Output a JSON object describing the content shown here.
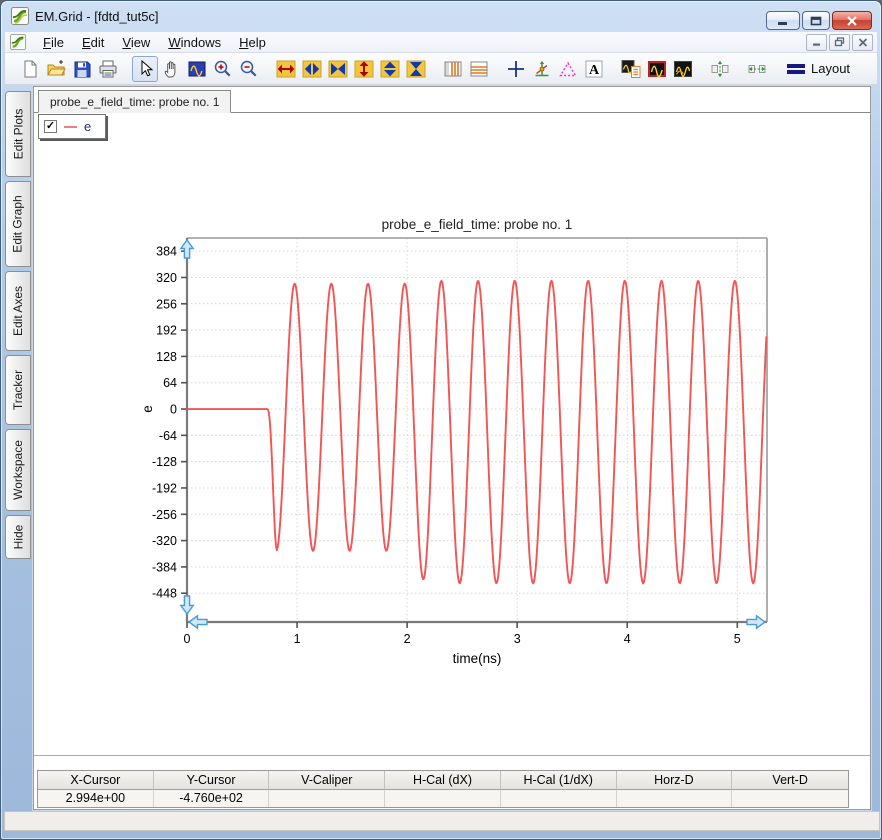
{
  "window": {
    "title": "EM.Grid - [fdtd_tut5c]",
    "controls": [
      "minimize",
      "maximize",
      "close"
    ],
    "child_controls": [
      "minimize",
      "restore",
      "close"
    ]
  },
  "menu": {
    "items": [
      {
        "label": "File",
        "underline": 0
      },
      {
        "label": "Edit",
        "underline": 0
      },
      {
        "label": "View",
        "underline": 0
      },
      {
        "label": "Windows",
        "underline": 0
      },
      {
        "label": "Help",
        "underline": 0
      }
    ]
  },
  "toolbar": {
    "pressed": "select-tool",
    "layout_label": "Layout",
    "groups": [
      [
        "new-document",
        "open-file",
        "save",
        "print"
      ],
      [
        "select-tool",
        "pan-tool",
        "zoom-window",
        "zoom-in",
        "zoom-out"
      ],
      [
        "h-expand",
        "h-shrink",
        "h-bowtie",
        "v-expand",
        "v-shrink",
        "v-bowtie"
      ],
      [
        "vertical-grid",
        "horizontal-grid"
      ],
      [
        "crosshair",
        "tracker-axes",
        "caliper-triangle",
        "text-label"
      ],
      [
        "plot-with-legend",
        "plot-single",
        "plot-multi"
      ],
      [
        "fit-vertical"
      ],
      [
        "fit-horizontal"
      ],
      [
        "layout"
      ]
    ]
  },
  "sidebar": {
    "tabs": [
      "Edit Plots",
      "Edit Graph",
      "Edit Axes",
      "Tracker",
      "Workspace",
      "Hide"
    ]
  },
  "document": {
    "tab_label": "probe_e_field_time: probe no. 1"
  },
  "legend": {
    "checked": true,
    "series_label": "e",
    "line_color": "#f08080"
  },
  "chart_data": {
    "type": "line",
    "title": "probe_e_field_time: probe no. 1",
    "xlabel": "time(ns)",
    "ylabel": "e",
    "xlim": [
      0,
      5.27
    ],
    "ylim": [
      -518,
      416
    ],
    "xticks": [
      0,
      1,
      2,
      3,
      4,
      5
    ],
    "yticks": [
      384,
      320,
      256,
      192,
      128,
      64,
      0,
      -64,
      -128,
      -192,
      -256,
      -320,
      -384,
      -448
    ],
    "grid": "dotted",
    "legend_position": "floating-top-left",
    "colors": {
      "curve": "#f35454",
      "axis": "#7a7a7a",
      "grid": "#d6d6d6",
      "pan_arrow_fill": "#cfe8fa",
      "pan_arrow_stroke": "#4a9bd5"
    },
    "series": [
      {
        "name": "e",
        "color": "#f35454",
        "waveform": {
          "shape": "flat zero then continuous 3 GHz sine burst, first swing negative",
          "flat_value": 0,
          "oscillation_start_ns": 0.728,
          "frequency_ghz": 3.0,
          "envelope_ramp_ns": 0.09,
          "initial_amplitude": 325,
          "initial_offset": -20,
          "final_amplitude": 368,
          "final_offset": -56,
          "transition_window_ns": [
            1.95,
            2.2
          ],
          "end_ns": 5.27,
          "approx_positive_peak": 310,
          "approx_negative_peak_early": -345,
          "approx_negative_peak_late": -424
        }
      }
    ]
  },
  "cursor_table": {
    "headers": [
      "X-Cursor",
      "Y-Cursor",
      "V-Caliper",
      "H-Cal (dX)",
      "H-Cal (1/dX)",
      "Horz-D",
      "Vert-D"
    ],
    "values": [
      "2.994e+00",
      "-4.760e+02",
      "",
      "",
      "",
      "",
      ""
    ]
  }
}
